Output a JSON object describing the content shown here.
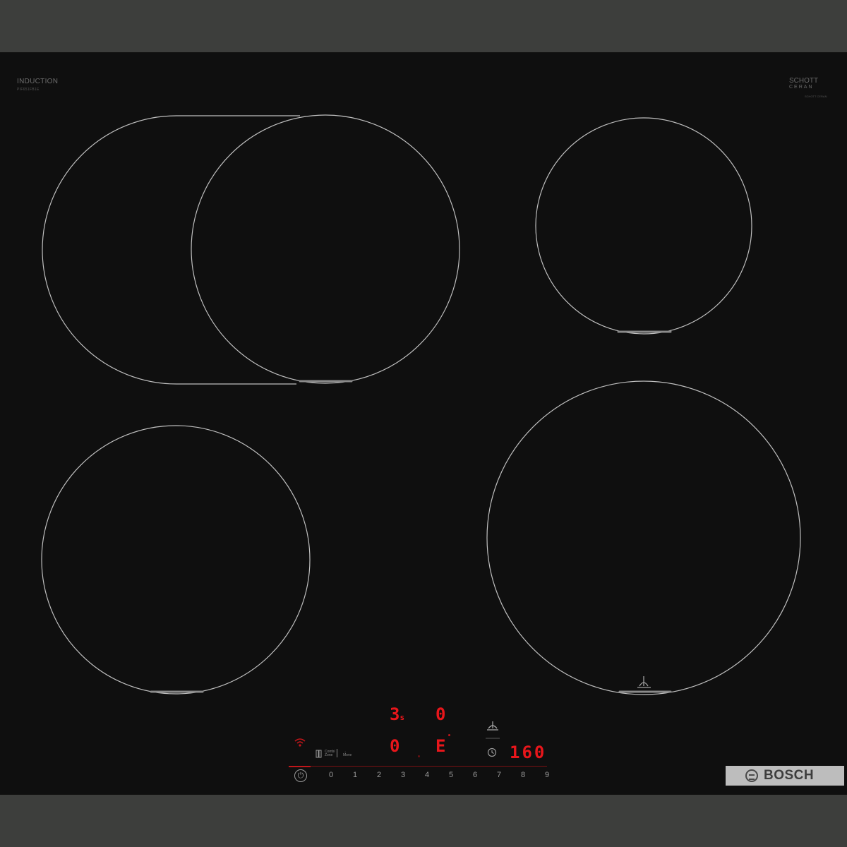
{
  "cooktop": {
    "type_label": "INDUCTION",
    "model_code": "PIF651FB1E",
    "glass_brand": "SCHOTT",
    "glass_line": "CERAN",
    "glass_tiny": "SCHOTT CERAN",
    "brand": "BOSCH"
  },
  "display": {
    "zone_left_value": "3",
    "zone_left_sub": "s",
    "zone_right_value": "0",
    "zone_bottom_left_value": "0",
    "zone_bottom_right_value": "E",
    "timer_value": "160"
  },
  "controls": {
    "combi_label_top": "Combi",
    "combi_label_bottom": "Zone",
    "pan_label_top": "→",
    "pan_label_bottom": "Move",
    "power_symbol": "⏻",
    "levels": [
      "0",
      "1",
      "2",
      "3",
      "4",
      "5",
      "6",
      "7",
      "8",
      "9"
    ]
  },
  "icons": {
    "wifi": "wifi-icon",
    "clock": "clock-icon",
    "pan_sensor": "frying-sensor-icon",
    "flex_zone": "flex-zone-icon"
  },
  "colors": {
    "glass": "#0f0f0f",
    "display_red": "#e8161b",
    "zone_outline": "#bfbfbf",
    "frame": "#3d3e3c"
  }
}
